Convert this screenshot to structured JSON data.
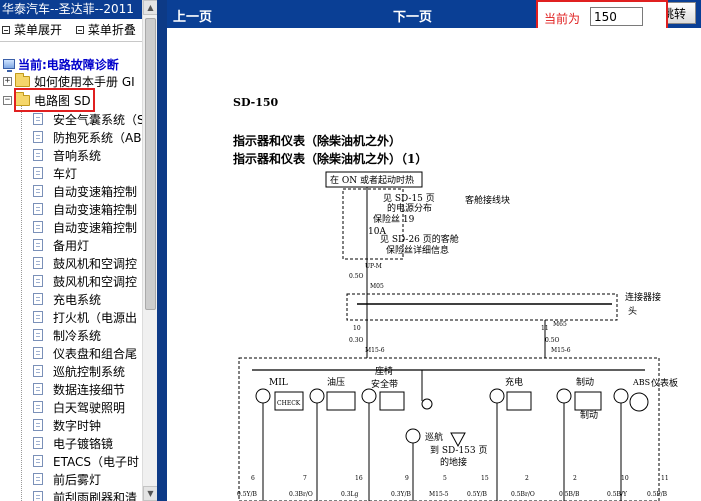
{
  "left_panel": {
    "title": "华泰汽车--圣达菲--2011",
    "menu": {
      "expand": "菜单展开",
      "collapse": "菜单折叠"
    },
    "current_label": "当前:电路故障诊断",
    "tree": {
      "top_folder": {
        "expander": "+",
        "label": "如何使用本手册  GI"
      },
      "open_folder": {
        "expander": "−",
        "label": "电路图  SD"
      },
      "children": [
        "安全气囊系统（S",
        "防抱死系统（AB",
        "音响系统",
        "车灯",
        "自动变速箱控制",
        "自动变速箱控制",
        "自动变速箱控制",
        "备用灯",
        "鼓风机和空调控",
        "鼓风机和空调控",
        "充电系统",
        "打火机（电源出",
        "制冷系统",
        "仪表盘和组合尾",
        "巡航控制系统",
        "数据连接细节",
        "白天驾驶照明",
        "数字时钟",
        "电子镀铬镜",
        "ETACS（电子时",
        "前后雾灯",
        "前刮雨刷器和清"
      ]
    },
    "scroll_up_icon": "scroll-up-arrow",
    "scroll_down_icon": "scroll-down-arrow"
  },
  "toolbar": {
    "prev_label": "上一页",
    "next_label": "下一页",
    "current_page_label": "当前为",
    "current_page_value": "150",
    "go_label": "跳转",
    "cut_char": "1"
  },
  "document": {
    "page_code": "SD-150",
    "heading1": "指示器和仪表（除柴油机之外）",
    "heading2": "指示器和仪表（除柴油机之外）（1）",
    "diagram": {
      "ign_box": "在 ON 或者起动时热",
      "see_sd15": "见 SD-15 页",
      "power_dist": "的电源分布",
      "cabin_block": "客舱接线块",
      "fuse": "保险丝 19",
      "fuse_amp": "10A",
      "see_sd26": "见 SD-26 页的客舱",
      "fuse_detail": "保险丝详细信息",
      "upm": "UP-M",
      "w_top_gauge": "0.5O",
      "conn_m05": "M05",
      "connector_block": "连接器接",
      "connector_block2": "头",
      "pin10": "10",
      "pin11": "11",
      "m65": "M65",
      "m15_6a": "M15-6",
      "m15_6b": "M15-6",
      "wire_03o": "0.3O",
      "wire_05o_a": "0.5O",
      "wire_05o_b": "0.5O",
      "seat_belt": "座椅",
      "seat_belt2": "安全带",
      "oil_press": "油压",
      "mil": "MIL",
      "check": "CHECK",
      "charge": "充电",
      "brake": "制动",
      "brake2": "制动",
      "abs": "ABS",
      "instrument": "仪表板",
      "cruise": "巡航",
      "see_sd153": "到 SD-153 页",
      "ground": "的地接",
      "bottom_labels": [
        "0.5Y/B",
        "0.3Br/O",
        "0.3Lg",
        "0.3Y/B",
        "M15-5",
        "0.5Y/B",
        "0.5Br/O",
        "0.5B/B",
        "0.5B/Y",
        "0.5P/B"
      ],
      "bottom_pins": [
        "6",
        "7",
        "16",
        "9",
        "5",
        "15",
        "2",
        "2",
        "10",
        "11"
      ]
    }
  },
  "colors": {
    "toolbar_bg": "#0a3f95",
    "highlight": "#e02020",
    "current_text": "#0000cc"
  }
}
